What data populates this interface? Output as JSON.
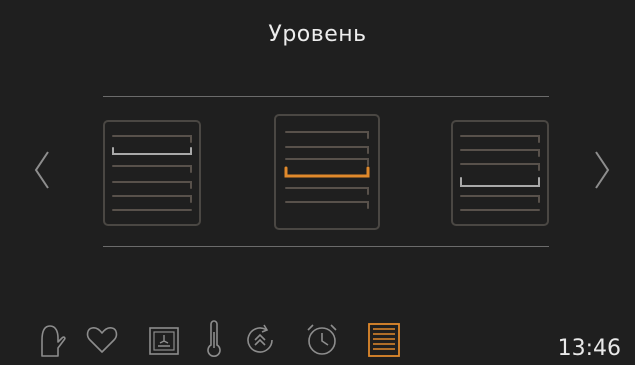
{
  "screen": {
    "title": "Уровень"
  },
  "level_selector": {
    "options": [
      {
        "name": "level-option-2",
        "selected": false
      },
      {
        "name": "level-option-3",
        "selected": true
      },
      {
        "name": "level-option-4",
        "selected": false
      }
    ],
    "prev_icon": "chevron-left-icon",
    "next_icon": "chevron-right-icon"
  },
  "bottom_bar": {
    "icons": [
      {
        "name": "oven-mitt-icon",
        "active": false
      },
      {
        "name": "heart-icon",
        "active": false
      },
      {
        "name": "fan-heating-icon",
        "active": false
      },
      {
        "name": "thermometer-icon",
        "active": false
      },
      {
        "name": "fast-preheat-icon",
        "active": false
      },
      {
        "name": "timer-icon",
        "active": false
      },
      {
        "name": "shelf-level-icon",
        "active": true
      }
    ],
    "clock": "13:46"
  },
  "colors": {
    "background": "#1f1f1f",
    "accent": "#e0892b",
    "icon": "#8d8d8d",
    "frame": "#4a4743",
    "rack": "#58514b",
    "selected_rack_inactive": "#a9a9a9"
  }
}
